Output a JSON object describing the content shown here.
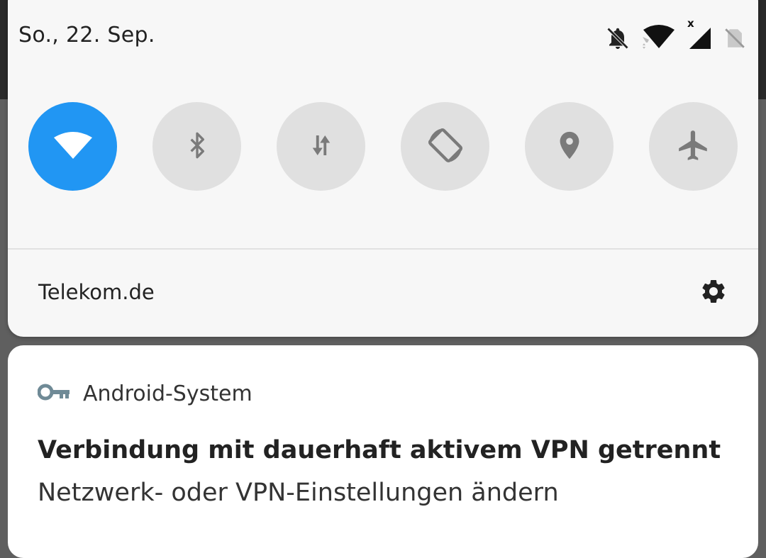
{
  "status_bar": {
    "date": "So., 22. Sep.",
    "icons": [
      "notifications-off-icon",
      "wifi-icon",
      "cell-signal-icon",
      "no-sim-icon"
    ],
    "cell_badge": "x"
  },
  "quick_settings": {
    "tiles": [
      {
        "name": "wifi",
        "icon": "wifi-icon",
        "active": true
      },
      {
        "name": "bluetooth",
        "icon": "bluetooth-icon",
        "active": false
      },
      {
        "name": "mobile-data",
        "icon": "data-transfer-icon",
        "active": false
      },
      {
        "name": "auto-rotate",
        "icon": "screen-rotation-icon",
        "active": false
      },
      {
        "name": "location",
        "icon": "location-pin-icon",
        "active": false
      },
      {
        "name": "airplane-mode",
        "icon": "airplane-icon",
        "active": false
      }
    ],
    "carrier": "Telekom.de",
    "colors": {
      "active": "#2196f3",
      "inactive": "#e0e0e0",
      "icon_inactive": "#7a7a7a"
    }
  },
  "notification": {
    "app_name": "Android-System",
    "app_icon": "vpn-key-icon",
    "title": "Verbindung mit dauerhaft aktivem VPN getrennt",
    "text": "Netzwerk- oder VPN-Einstellungen ändern"
  }
}
